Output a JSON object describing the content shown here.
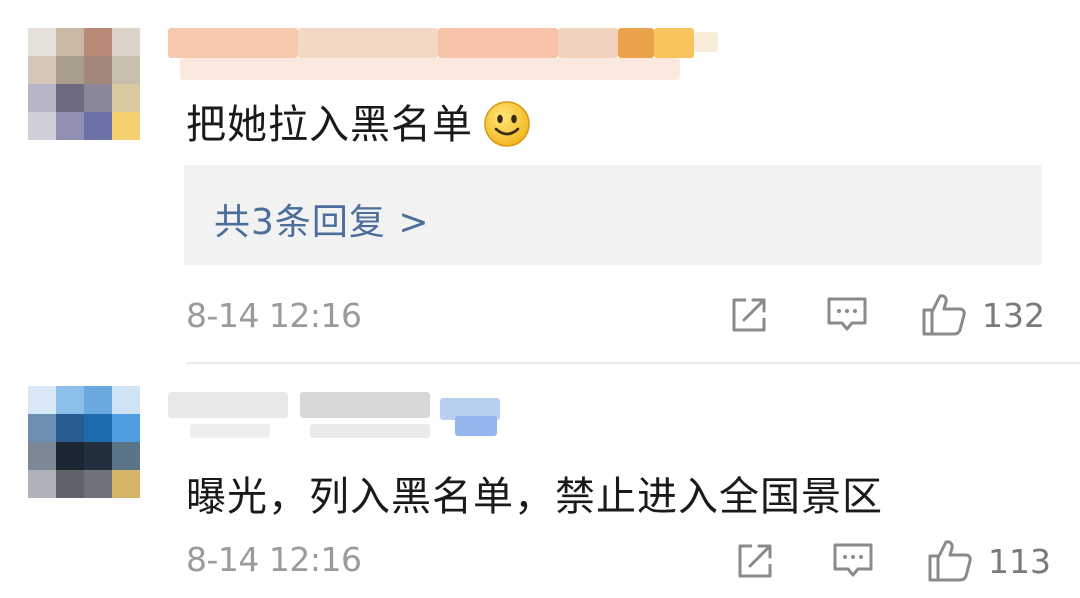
{
  "comments": [
    {
      "text": "把她拉入黑名单",
      "emoji": "smile-emoji",
      "replies_label": "共3条回复 >",
      "timestamp": "8-14 12:16",
      "like_count": "132"
    },
    {
      "text": "曝光，列入黑名单，禁止进入全国景区",
      "timestamp": "8-14 12:16",
      "like_count": "113"
    }
  ],
  "icons": {
    "share": "share-icon",
    "comment": "comment-icon",
    "like": "thumbs-up-icon"
  },
  "colors": {
    "link": "#4c6e9a",
    "muted": "#9b9b9b",
    "reply_bg": "#f2f2f2"
  }
}
